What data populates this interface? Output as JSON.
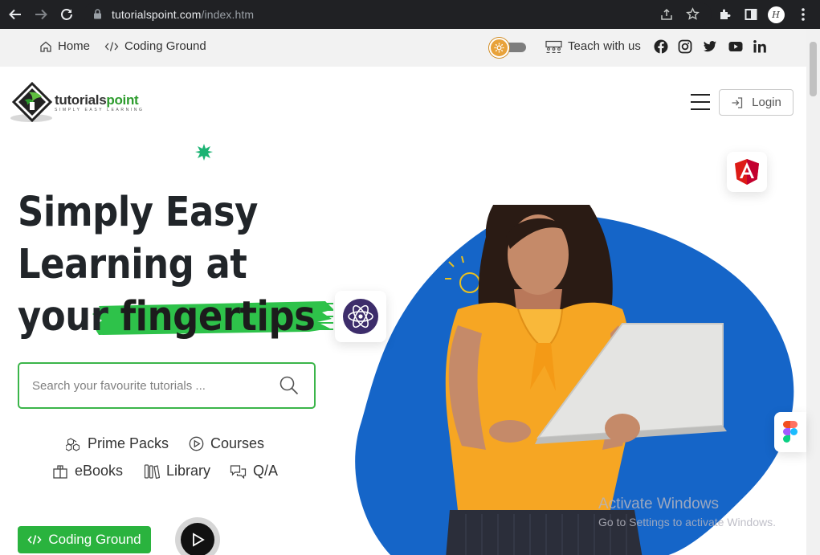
{
  "browser": {
    "url_domain": "tutorialspoint.com",
    "url_path": "/index.htm",
    "profile_initial": "H"
  },
  "topbar": {
    "home_label": "Home",
    "coding_ground_label": "Coding Ground",
    "teach_label": "Teach with us",
    "social_icons": [
      "facebook-icon",
      "instagram-icon",
      "twitter-icon",
      "youtube-icon",
      "linkedin-icon"
    ]
  },
  "header": {
    "logo_text_a": "tutorials",
    "logo_text_b": "point",
    "logo_tagline": "SIMPLY EASY LEARNING",
    "login_label": "Login"
  },
  "hero": {
    "line1": "Simply Easy",
    "line2": "Learning at",
    "line3_a": "your ",
    "line3_b": "fingertips",
    "search_placeholder": "Search your favourite tutorials ...",
    "links": {
      "prime_packs": "Prime Packs",
      "courses": "Courses",
      "ebooks": "eBooks",
      "library": "Library",
      "qa": "Q/A"
    },
    "cta_label": "Coding Ground"
  },
  "watermark": {
    "line1": "Activate Windows",
    "line2": "Go to Settings to activate Windows."
  },
  "colors": {
    "brand_green": "#2ab33e",
    "hero_blue": "#1565c8",
    "chrome_dark": "#202124",
    "topbar_bg": "#f2f2f2"
  }
}
